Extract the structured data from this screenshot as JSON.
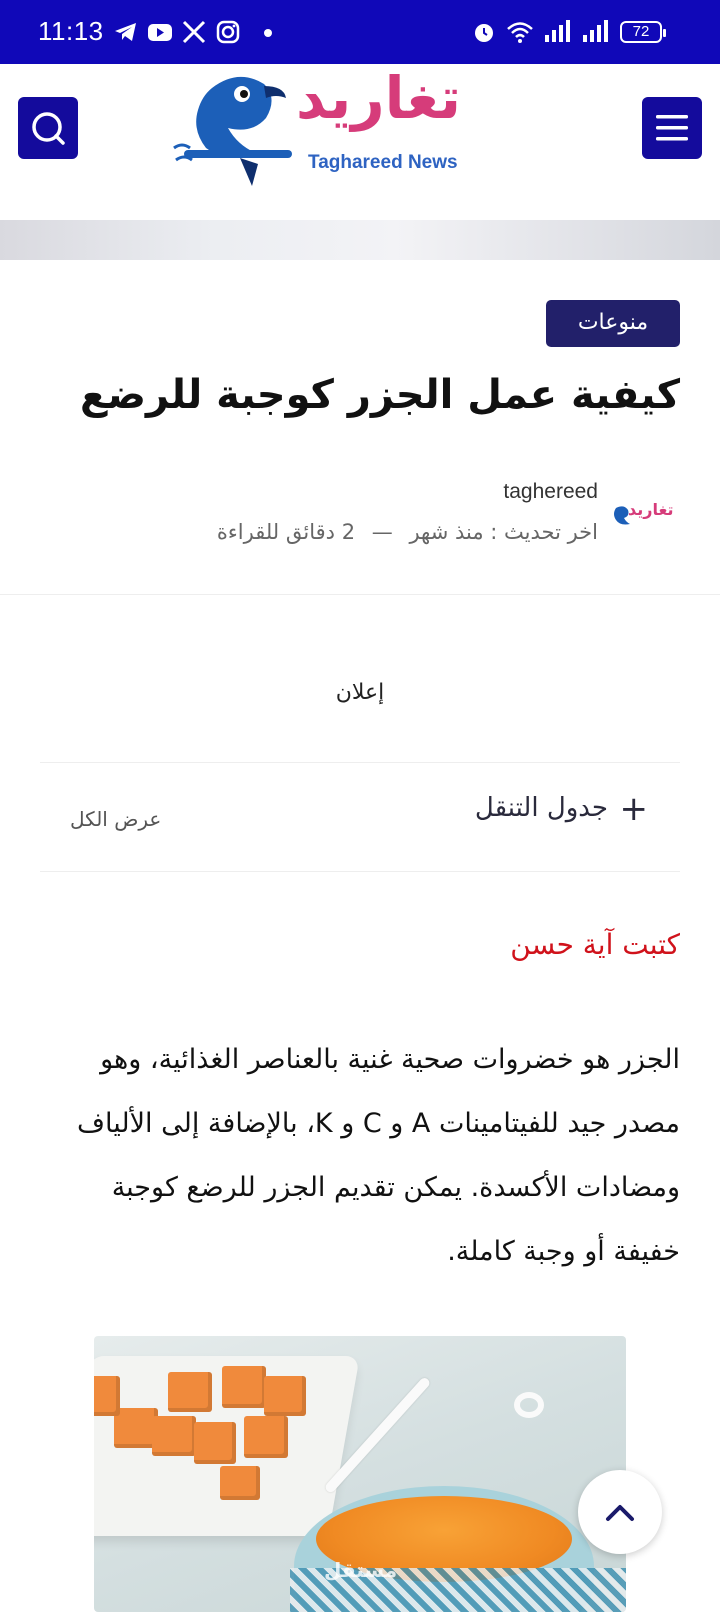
{
  "status_bar": {
    "time": "11:13",
    "battery": "72",
    "left_icons": [
      "telegram-icon",
      "youtube-icon",
      "x-icon",
      "instagram-icon",
      "dot-icon"
    ],
    "right_icons": [
      "alarm-icon",
      "wifi-icon",
      "signal-icon",
      "signal-icon",
      "battery-icon"
    ]
  },
  "header": {
    "logo_arabic": "تغاريد",
    "logo_english": "Taghareed News",
    "menu_icon": "menu-icon",
    "search_icon": "search-icon",
    "accent_color": "#140b9c"
  },
  "article": {
    "category": "منوعات",
    "title": "كيفية عمل الجزر كوجبة للرضع",
    "author": "taghereed",
    "last_update": "اخر تحديث : منذ شهر",
    "separator": "—",
    "read_time": "2 دقائق للقراءة",
    "avatar_text": "تغاريد",
    "ad_label": "إعلان",
    "byline": "كتبت آية حسن",
    "byline_color": "#d0121b",
    "body": "الجزر هو خضروات صحية غنية بالعناصر الغذائية، وهو مصدر جيد للفيتامينات A و C و K، بالإضافة إلى الألياف ومضادات الأكسدة. يمكن تقديم الجزر للرضع كوجبة خفيفة أو وجبة كاملة."
  },
  "toc": {
    "title": "جدول التنقل",
    "show_all": "عرض الكل",
    "toggle": "+"
  },
  "image": {
    "watermark": "مستقل"
  }
}
